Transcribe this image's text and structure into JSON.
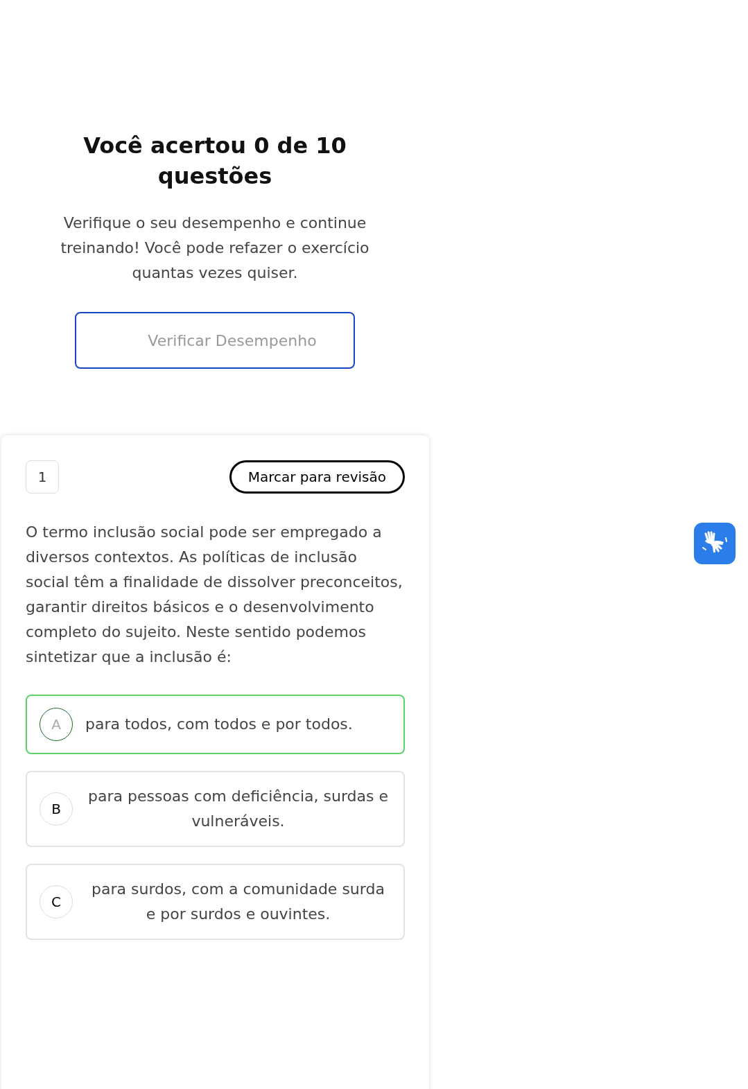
{
  "result": {
    "title": "Você acertou 0 de 10 questões",
    "message": "Verifique o seu desempenho e continue treinando! Você pode refazer o exercício quantas vezes quiser.",
    "button": "Verificar Desempenho"
  },
  "question": {
    "number": "1",
    "review_button": "Marcar para revisão",
    "text": "O termo inclusão social pode ser empregado a diversos contextos. As políticas de inclusão social têm a finalidade de dissolver preconceitos, garantir direitos básicos e o desenvolvimento completo do sujeito. Neste sentido podemos sintetizar que a inclusão é:",
    "options": [
      {
        "letter": "A",
        "text": "para todos, com todos e por todos.",
        "correct": true
      },
      {
        "letter": "B",
        "text": "para pessoas com deficiência, surdas e vulneráveis.",
        "correct": false
      },
      {
        "letter": "C",
        "text": "para surdos, com a comunidade surda e por surdos e ouvintes.",
        "correct": false
      }
    ]
  }
}
